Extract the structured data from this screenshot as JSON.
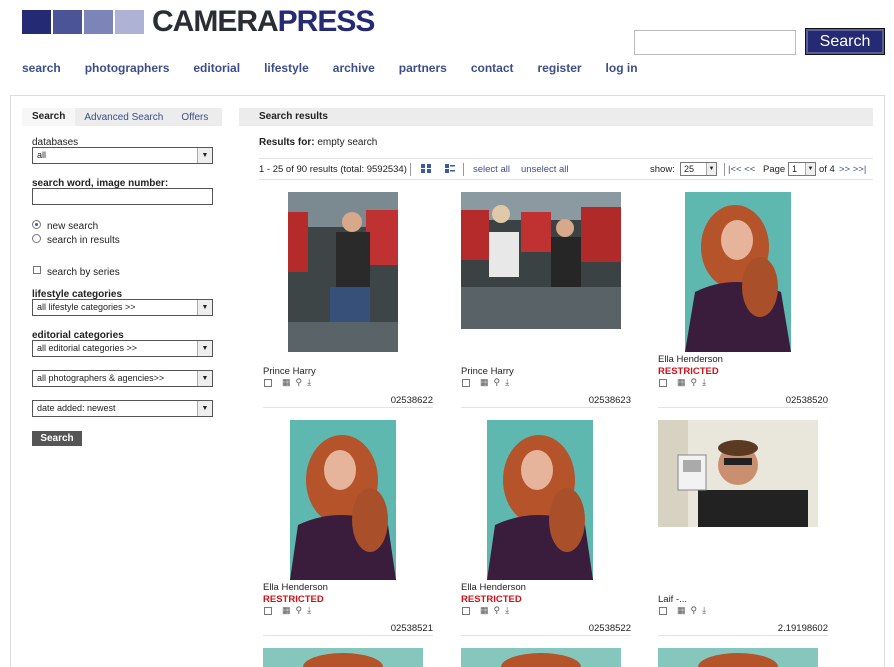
{
  "header": {
    "logo_part1": "CAMERA",
    "logo_part2": "PRESS",
    "search_value": "",
    "search_button": "Search"
  },
  "nav": [
    "search",
    "photographers",
    "editorial",
    "lifestyle",
    "archive",
    "partners",
    "contact",
    "register",
    "log in"
  ],
  "sidebar": {
    "tabs": {
      "search": "Search",
      "advanced": "Advanced Search",
      "offers": "Offers"
    },
    "databases_label": "databases",
    "databases_value": "all",
    "search_word_label": "search word, image number:",
    "search_word_value": "",
    "radio_new": "new search",
    "radio_in_results": "search in results",
    "series_label": "search by series",
    "lifestyle_label": "lifestyle categories",
    "lifestyle_value": "all lifestyle categories >>",
    "editorial_label": "editorial categories",
    "editorial_value": "all editorial categories >>",
    "photographers_value": "all photographers & agencies>>",
    "sort_value": "date added: newest",
    "search_button": "Search"
  },
  "results": {
    "header": "Search results",
    "for_label": "Results for:",
    "for_value": "empty search",
    "count_text": "1 - 25 of 90 results (total: 9592534)",
    "select_all": "select all",
    "unselect_all": "unselect all",
    "show_label": "show:",
    "show_value": "25",
    "first_prev": "|<< <<",
    "page_label": "Page",
    "page_value": "1",
    "of_label": "of 4",
    "next_last": ">> >>|"
  },
  "tiles": [
    {
      "caption": "Prince Harry",
      "restricted": "",
      "id": "02538622"
    },
    {
      "caption": "Prince Harry",
      "restricted": "",
      "id": "02538623"
    },
    {
      "caption": "Ella Henderson",
      "restricted": "RESTRICTED",
      "id": "02538520"
    },
    {
      "caption": "Ella Henderson",
      "restricted": "RESTRICTED",
      "id": "02538521"
    },
    {
      "caption": "Ella Henderson",
      "restricted": "RESTRICTED",
      "id": "02538522"
    },
    {
      "caption": "Laif -...",
      "restricted": "",
      "id": "2.19198602"
    }
  ],
  "colors": {
    "brand_navy": "#242a73",
    "link": "#3c4e8a",
    "restricted": "#d0121a"
  }
}
